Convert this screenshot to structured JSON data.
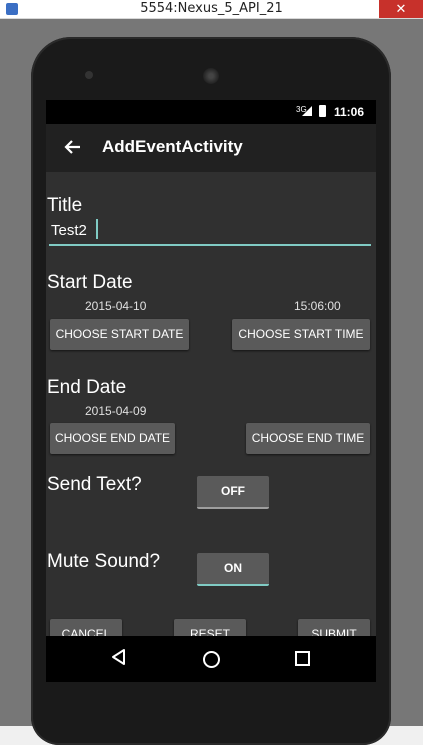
{
  "window": {
    "title": "5554:Nexus_5_API_21",
    "close_label": "✕"
  },
  "statusbar": {
    "network": "3G",
    "time": "11:06"
  },
  "appbar": {
    "title": "AddEventActivity"
  },
  "form": {
    "title_label": "Title",
    "title_value": "Test2",
    "start_date_label": "Start Date",
    "start_date_value": "2015-04-10",
    "start_time_value": "15:06:00",
    "choose_start_date": "CHOOSE START DATE",
    "choose_start_time": "CHOOSE START TIME",
    "end_date_label": "End Date",
    "end_date_value": "2015-04-09",
    "choose_end_date": "CHOOSE END DATE",
    "choose_end_time": "CHOOSE END TIME",
    "send_text_label": "Send Text?",
    "send_text_state": "OFF",
    "mute_sound_label": "Mute Sound?",
    "mute_sound_state": "ON"
  },
  "actions": {
    "cancel": "CANCEL",
    "reset": "RESET",
    "submit": "SUBMIT"
  },
  "colors": {
    "accent": "#80cbc4",
    "appbar": "#212121",
    "background": "#303030",
    "button": "#5a5a5a"
  }
}
